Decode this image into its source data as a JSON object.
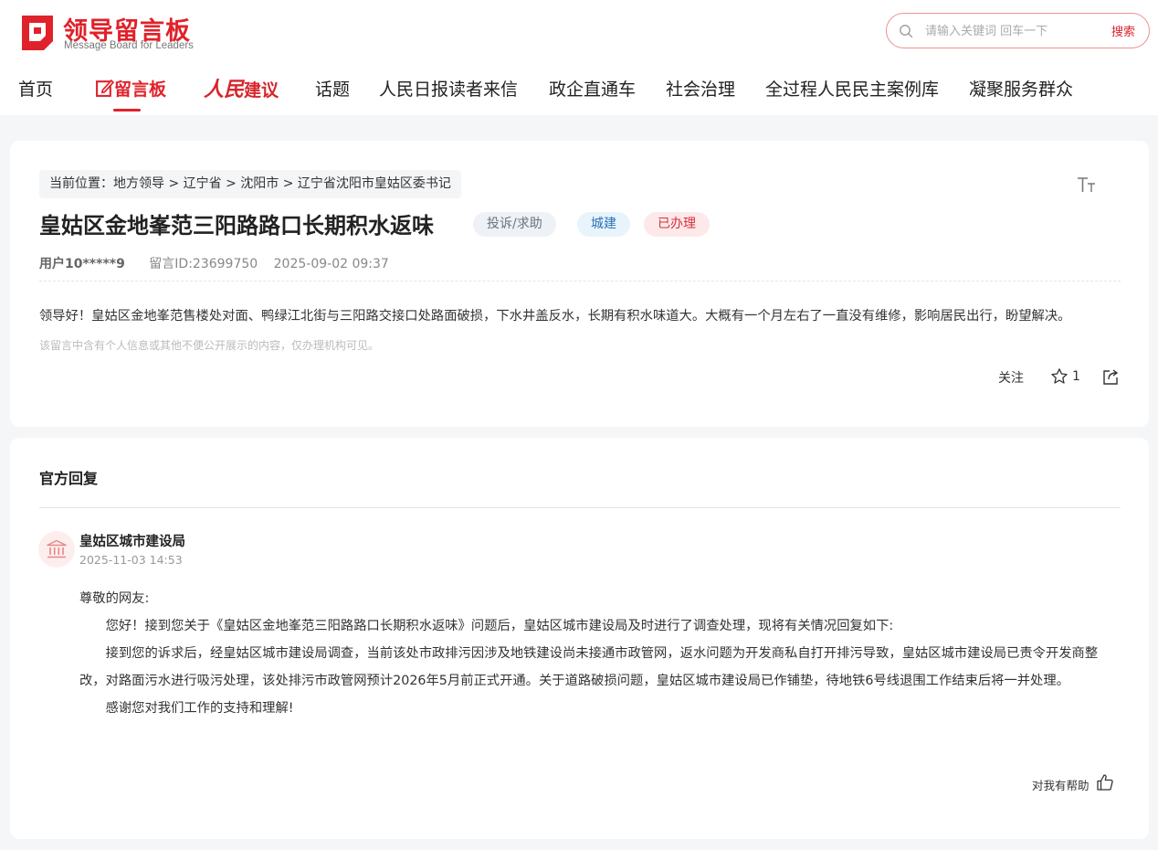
{
  "header": {
    "logo_title": "领导留言板",
    "logo_subtitle": "Message Board for Leaders",
    "brand_color": "#e0222b",
    "search": {
      "placeholder": "请输入关键词 回车一下",
      "button_label": "搜索"
    },
    "nav": [
      {
        "label": "首页"
      },
      {
        "label": "留言板",
        "active": true
      },
      {
        "label_part1": "人民",
        "label_part2": "建议"
      },
      {
        "label": "话题"
      },
      {
        "label": "人民日报读者来信"
      },
      {
        "label": "政企直通车"
      },
      {
        "label": "社会治理"
      },
      {
        "label": "全过程人民民主案例库"
      },
      {
        "label": "凝聚服务群众"
      }
    ]
  },
  "message": {
    "breadcrumb": "当前位置：地方领导 > 辽宁省 > 沈阳市 > 辽宁省沈阳市皇姑区委书记",
    "title": "皇姑区金地峯范三阳路路口长期积水返味",
    "tags": {
      "type": "投诉/求助",
      "category": "城建",
      "status": "已办理"
    },
    "user": "用户10*****9",
    "message_id": "留言ID:23699750",
    "datetime": "2025-09-02 09:37",
    "content": "领导好！皇姑区金地峯范售楼处对面、鸭绿江北街与三阳路交接口处路面破损，下水井盖反水，长期有积水味道大。大概有一个月左右了一直没有维修，影响居民出行，盼望解决。",
    "privacy_note": "该留言中含有个人信息或其他不便公开展示的内容，仅办理机构可见。",
    "actions": {
      "follow_label": "关注",
      "like_count": "1"
    }
  },
  "reply": {
    "section_title": "官方回复",
    "department": "皇姑区城市建设局",
    "datetime": "2025-11-03 14:53",
    "greeting": "尊敬的网友:",
    "para1": "您好！接到您关于《皇姑区金地峯范三阳路路口长期积水返味》问题后，皇姑区城市建设局及时进行了调查处理，现将有关情况回复如下:",
    "para2": "接到您的诉求后，经皇姑区城市建设局调查，当前该处市政排污因涉及地铁建设尚未接通市政管网，返水问题为开发商私自打开排污导致，皇姑区城市建设局已责令开发商整改，对路面污水进行吸污处理，该处排污市政管网预计2026年5月前正式开通。关于道路破损问题，皇姑区城市建设局已作铺垫，待地铁6号线退围工作结束后将一并处理。",
    "para3": "感谢您对我们工作的支持和理解!",
    "helpful_label": "对我有帮助"
  }
}
